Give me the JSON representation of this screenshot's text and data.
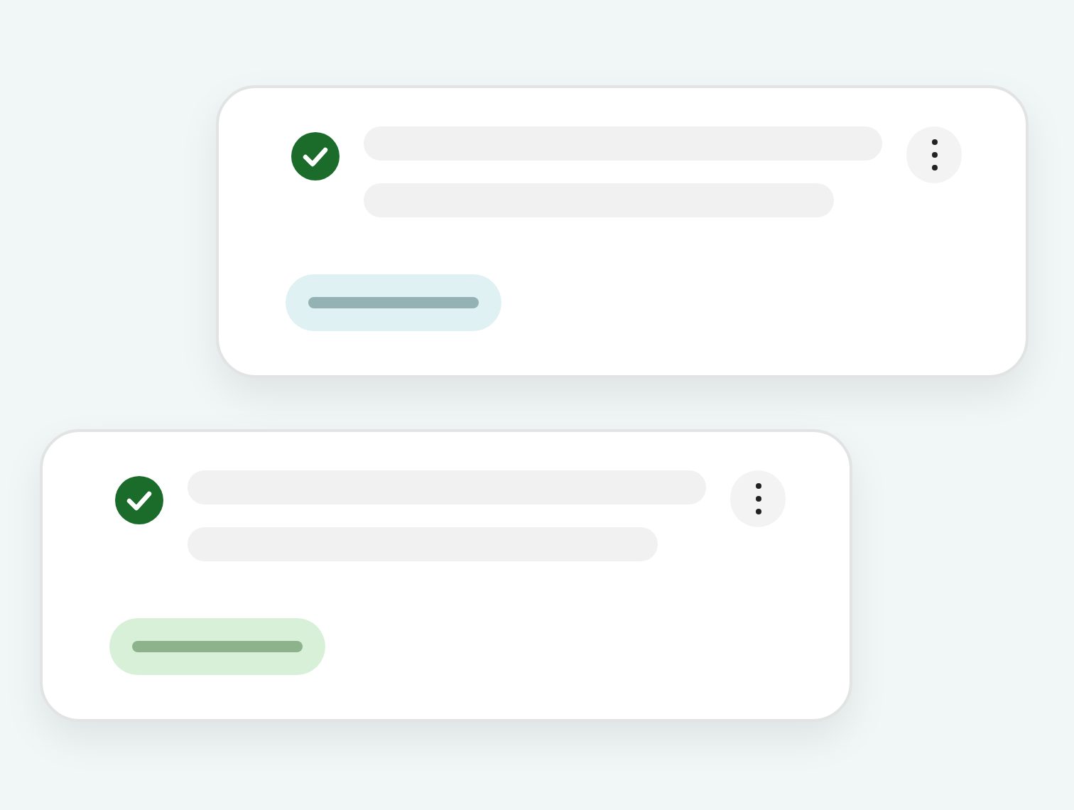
{
  "cards": [
    {
      "done": true,
      "tag": {
        "color": "#dff1f3"
      }
    },
    {
      "done": true,
      "tag": {
        "color": "#d8f0d8"
      }
    }
  ]
}
